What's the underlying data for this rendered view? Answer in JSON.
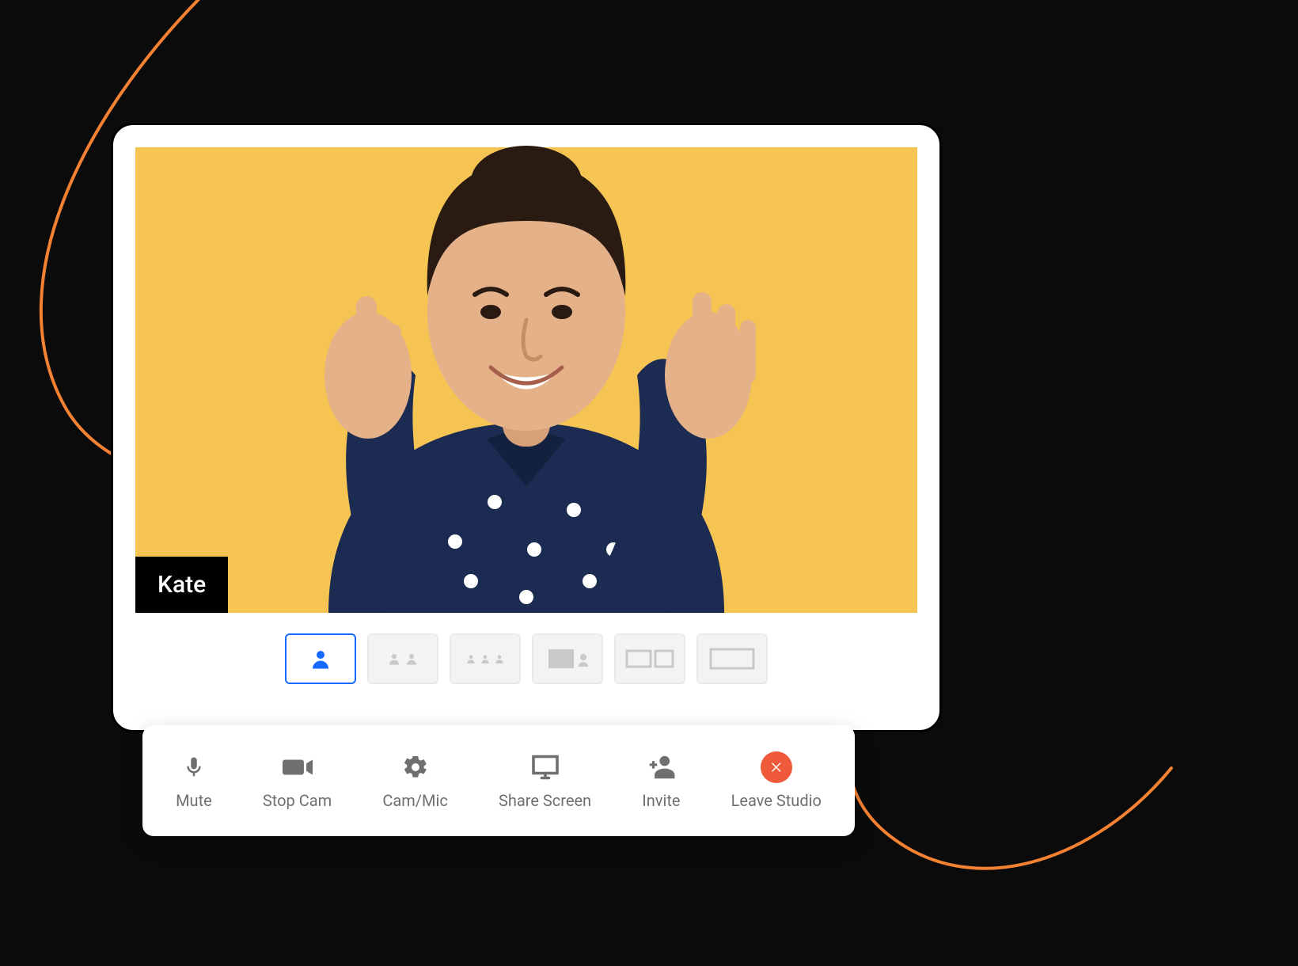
{
  "video": {
    "participant_name": "Kate",
    "background_color": "#f5c453"
  },
  "layouts": {
    "active_index": 0,
    "options": [
      "single",
      "two-up",
      "three-up",
      "screen-pip",
      "screen-split",
      "screen-full"
    ]
  },
  "toolbar": {
    "mute_label": "Mute",
    "stopcam_label": "Stop Cam",
    "cammic_label": "Cam/Mic",
    "sharescreen_label": "Share Screen",
    "invite_label": "Invite",
    "leave_label": "Leave Studio"
  },
  "colors": {
    "accent": "#1569ff",
    "swoosh": "#f58233",
    "leave": "#ee5a3a"
  }
}
